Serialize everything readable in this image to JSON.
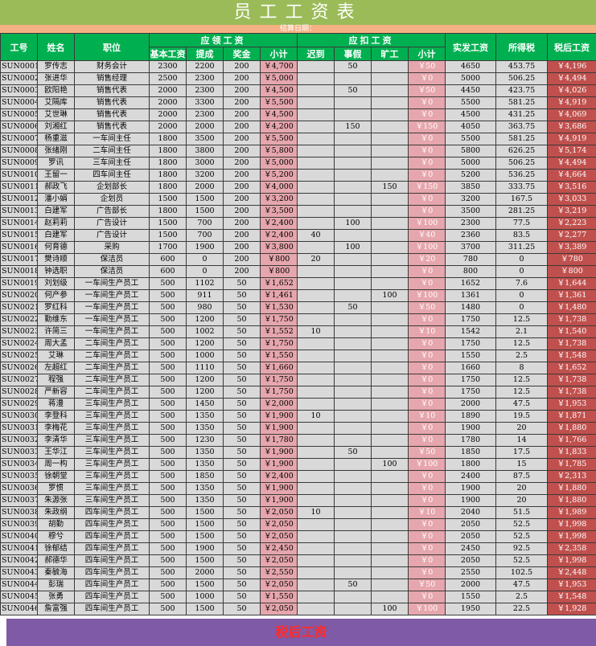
{
  "title": "员工工资表",
  "date_label": "结算日期：",
  "headers": {
    "id": "工号",
    "name": "姓名",
    "position": "职位",
    "payable_group": "应领工资",
    "base": "基本工资",
    "commission": "提成",
    "bonus": "奖金",
    "payable_subtotal": "小计",
    "deduct_group": "应扣工资",
    "late": "迟到",
    "leave": "事假",
    "absent": "旷工",
    "deduct_subtotal": "小计",
    "actual": "实发工资",
    "tax": "所得税",
    "after_tax": "税后工资"
  },
  "rows": [
    {
      "id": "SUN0001",
      "name": "罗传志",
      "position": "财务会计",
      "base": "2300",
      "commission": "2200",
      "bonus": "200",
      "subtotal": "￥4,700",
      "late": "",
      "leave": "50",
      "absent": "",
      "deduct": "￥50",
      "actual": "4650",
      "tax": "453.75",
      "after_tax": "￥4,196"
    },
    {
      "id": "SUN0002",
      "name": "张进华",
      "position": "销售经理",
      "base": "2500",
      "commission": "2300",
      "bonus": "200",
      "subtotal": "￥5,000",
      "late": "",
      "leave": "",
      "absent": "",
      "deduct": "￥0",
      "actual": "5000",
      "tax": "506.25",
      "after_tax": "￥4,494"
    },
    {
      "id": "SUN0003",
      "name": "欧阳艳",
      "position": "销售代表",
      "base": "2000",
      "commission": "2300",
      "bonus": "200",
      "subtotal": "￥4,500",
      "late": "",
      "leave": "50",
      "absent": "",
      "deduct": "￥50",
      "actual": "4450",
      "tax": "423.75",
      "after_tax": "￥4,026"
    },
    {
      "id": "SUN0004",
      "name": "艾隔库",
      "position": "销售代表",
      "base": "2000",
      "commission": "3300",
      "bonus": "200",
      "subtotal": "￥5,500",
      "late": "",
      "leave": "",
      "absent": "",
      "deduct": "￥0",
      "actual": "5500",
      "tax": "581.25",
      "after_tax": "￥4,919"
    },
    {
      "id": "SUN0005",
      "name": "艾世琳",
      "position": "销售代表",
      "base": "2000",
      "commission": "2300",
      "bonus": "200",
      "subtotal": "￥4,500",
      "late": "",
      "leave": "",
      "absent": "",
      "deduct": "￥0",
      "actual": "4500",
      "tax": "431.25",
      "after_tax": "￥4,069"
    },
    {
      "id": "SUN0006",
      "name": "刘湘红",
      "position": "销售代表",
      "base": "2000",
      "commission": "2000",
      "bonus": "200",
      "subtotal": "￥4,200",
      "late": "",
      "leave": "150",
      "absent": "",
      "deduct": "￥150",
      "actual": "4050",
      "tax": "363.75",
      "after_tax": "￥3,686"
    },
    {
      "id": "SUN0007",
      "name": "杨重滋",
      "position": "一车间主任",
      "base": "1800",
      "commission": "3500",
      "bonus": "200",
      "subtotal": "￥5,500",
      "late": "",
      "leave": "",
      "absent": "",
      "deduct": "￥0",
      "actual": "5500",
      "tax": "581.25",
      "after_tax": "￥4,919"
    },
    {
      "id": "SUN0008",
      "name": "张绪刚",
      "position": "二车间主任",
      "base": "1800",
      "commission": "3800",
      "bonus": "200",
      "subtotal": "￥5,800",
      "late": "",
      "leave": "",
      "absent": "",
      "deduct": "￥0",
      "actual": "5800",
      "tax": "626.25",
      "after_tax": "￥5,174"
    },
    {
      "id": "SUN0009",
      "name": "罗讯",
      "position": "三车间主任",
      "base": "1800",
      "commission": "3000",
      "bonus": "200",
      "subtotal": "￥5,000",
      "late": "",
      "leave": "",
      "absent": "",
      "deduct": "￥0",
      "actual": "5000",
      "tax": "506.25",
      "after_tax": "￥4,494"
    },
    {
      "id": "SUN0010",
      "name": "王留一",
      "position": "四车间主任",
      "base": "1800",
      "commission": "3200",
      "bonus": "200",
      "subtotal": "￥5,200",
      "late": "",
      "leave": "",
      "absent": "",
      "deduct": "￥0",
      "actual": "5200",
      "tax": "536.25",
      "after_tax": "￥4,664"
    },
    {
      "id": "SUN0011",
      "name": "郝政飞",
      "position": "企划部长",
      "base": "1800",
      "commission": "2000",
      "bonus": "200",
      "subtotal": "￥4,000",
      "late": "",
      "leave": "",
      "absent": "150",
      "deduct": "￥150",
      "actual": "3850",
      "tax": "333.75",
      "after_tax": "￥3,516"
    },
    {
      "id": "SUN0012",
      "name": "潘小娟",
      "position": "企划员",
      "base": "1500",
      "commission": "1500",
      "bonus": "200",
      "subtotal": "￥3,200",
      "late": "",
      "leave": "",
      "absent": "",
      "deduct": "￥0",
      "actual": "3200",
      "tax": "167.5",
      "after_tax": "￥3,033"
    },
    {
      "id": "SUN0013",
      "name": "白建军",
      "position": "广告部长",
      "base": "1800",
      "commission": "1500",
      "bonus": "200",
      "subtotal": "￥3,500",
      "late": "",
      "leave": "",
      "absent": "",
      "deduct": "￥0",
      "actual": "3500",
      "tax": "281.25",
      "after_tax": "￥3,219"
    },
    {
      "id": "SUN0014",
      "name": "赵莉莉",
      "position": "广告设计",
      "base": "1500",
      "commission": "700",
      "bonus": "200",
      "subtotal": "￥2,400",
      "late": "",
      "leave": "100",
      "absent": "",
      "deduct": "￥100",
      "actual": "2300",
      "tax": "77.5",
      "after_tax": "￥2,223"
    },
    {
      "id": "SUN0015",
      "name": "白建军",
      "position": "广告设计",
      "base": "1500",
      "commission": "700",
      "bonus": "200",
      "subtotal": "￥2,400",
      "late": "40",
      "leave": "",
      "absent": "",
      "deduct": "￥40",
      "actual": "2360",
      "tax": "83.5",
      "after_tax": "￥2,277"
    },
    {
      "id": "SUN0016",
      "name": "何育德",
      "position": "采购",
      "base": "1700",
      "commission": "1900",
      "bonus": "200",
      "subtotal": "￥3,800",
      "late": "",
      "leave": "100",
      "absent": "",
      "deduct": "￥100",
      "actual": "3700",
      "tax": "311.25",
      "after_tax": "￥3,389"
    },
    {
      "id": "SUN0017",
      "name": "樊诗顺",
      "position": "保洁员",
      "base": "600",
      "commission": "0",
      "bonus": "200",
      "subtotal": "￥800",
      "late": "20",
      "leave": "",
      "absent": "",
      "deduct": "￥20",
      "actual": "780",
      "tax": "0",
      "after_tax": "￥780"
    },
    {
      "id": "SUN0018",
      "name": "钟选职",
      "position": "保洁员",
      "base": "600",
      "commission": "0",
      "bonus": "200",
      "subtotal": "￥800",
      "late": "",
      "leave": "",
      "absent": "",
      "deduct": "￥0",
      "actual": "800",
      "tax": "0",
      "after_tax": "￥800"
    },
    {
      "id": "SUN0019",
      "name": "刘划级",
      "position": "一车间生产员工",
      "base": "500",
      "commission": "1102",
      "bonus": "50",
      "subtotal": "￥1,652",
      "late": "",
      "leave": "",
      "absent": "",
      "deduct": "￥0",
      "actual": "1652",
      "tax": "7.6",
      "after_tax": "￥1,644"
    },
    {
      "id": "SUN0020",
      "name": "何产参",
      "position": "一车间生产员工",
      "base": "500",
      "commission": "911",
      "bonus": "50",
      "subtotal": "￥1,461",
      "late": "",
      "leave": "",
      "absent": "100",
      "deduct": "￥100",
      "actual": "1361",
      "tax": "0",
      "after_tax": "￥1,361"
    },
    {
      "id": "SUN0021",
      "name": "罗红科",
      "position": "一车间生产员工",
      "base": "500",
      "commission": "980",
      "bonus": "50",
      "subtotal": "￥1,530",
      "late": "",
      "leave": "50",
      "absent": "",
      "deduct": "￥50",
      "actual": "1480",
      "tax": "0",
      "after_tax": "￥1,480"
    },
    {
      "id": "SUN0022",
      "name": "勤维东",
      "position": "一车间生产员工",
      "base": "500",
      "commission": "1200",
      "bonus": "50",
      "subtotal": "￥1,750",
      "late": "",
      "leave": "",
      "absent": "",
      "deduct": "￥0",
      "actual": "1750",
      "tax": "12.5",
      "after_tax": "￥1,738"
    },
    {
      "id": "SUN0023",
      "name": "许简三",
      "position": "一车间生产员工",
      "base": "500",
      "commission": "1002",
      "bonus": "50",
      "subtotal": "￥1,552",
      "late": "10",
      "leave": "",
      "absent": "",
      "deduct": "￥10",
      "actual": "1542",
      "tax": "2.1",
      "after_tax": "￥1,540"
    },
    {
      "id": "SUN0024",
      "name": "周大孟",
      "position": "二车间生产员工",
      "base": "500",
      "commission": "1200",
      "bonus": "50",
      "subtotal": "￥1,750",
      "late": "",
      "leave": "",
      "absent": "",
      "deduct": "￥0",
      "actual": "1750",
      "tax": "12.5",
      "after_tax": "￥1,738"
    },
    {
      "id": "SUN0025",
      "name": "艾琳",
      "position": "二车间生产员工",
      "base": "500",
      "commission": "1000",
      "bonus": "50",
      "subtotal": "￥1,550",
      "late": "",
      "leave": "",
      "absent": "",
      "deduct": "￥0",
      "actual": "1550",
      "tax": "2.5",
      "after_tax": "￥1,548"
    },
    {
      "id": "SUN0026",
      "name": "左超红",
      "position": "二车间生产员工",
      "base": "500",
      "commission": "1110",
      "bonus": "50",
      "subtotal": "￥1,660",
      "late": "",
      "leave": "",
      "absent": "",
      "deduct": "￥0",
      "actual": "1660",
      "tax": "8",
      "after_tax": "￥1,652"
    },
    {
      "id": "SUN0027",
      "name": "程强",
      "position": "二车间生产员工",
      "base": "500",
      "commission": "1200",
      "bonus": "50",
      "subtotal": "￥1,750",
      "late": "",
      "leave": "",
      "absent": "",
      "deduct": "￥0",
      "actual": "1750",
      "tax": "12.5",
      "after_tax": "￥1,738"
    },
    {
      "id": "SUN0028",
      "name": "严新容",
      "position": "二车间生产员工",
      "base": "500",
      "commission": "1200",
      "bonus": "50",
      "subtotal": "￥1,750",
      "late": "",
      "leave": "",
      "absent": "",
      "deduct": "￥0",
      "actual": "1750",
      "tax": "12.5",
      "after_tax": "￥1,738"
    },
    {
      "id": "SUN0029",
      "name": "蒋澧",
      "position": "三车间生产员工",
      "base": "500",
      "commission": "1450",
      "bonus": "50",
      "subtotal": "￥2,000",
      "late": "",
      "leave": "",
      "absent": "",
      "deduct": "￥0",
      "actual": "2000",
      "tax": "47.5",
      "after_tax": "￥1,953"
    },
    {
      "id": "SUN0030",
      "name": "李登科",
      "position": "三车间生产员工",
      "base": "500",
      "commission": "1350",
      "bonus": "50",
      "subtotal": "￥1,900",
      "late": "10",
      "leave": "",
      "absent": "",
      "deduct": "￥10",
      "actual": "1890",
      "tax": "19.5",
      "after_tax": "￥1,871"
    },
    {
      "id": "SUN0031",
      "name": "李梅花",
      "position": "三车间生产员工",
      "base": "500",
      "commission": "1350",
      "bonus": "50",
      "subtotal": "￥1,900",
      "late": "",
      "leave": "",
      "absent": "",
      "deduct": "￥0",
      "actual": "1900",
      "tax": "20",
      "after_tax": "￥1,880"
    },
    {
      "id": "SUN0032",
      "name": "李清华",
      "position": "三车间生产员工",
      "base": "500",
      "commission": "1230",
      "bonus": "50",
      "subtotal": "￥1,780",
      "late": "",
      "leave": "",
      "absent": "",
      "deduct": "￥0",
      "actual": "1780",
      "tax": "14",
      "after_tax": "￥1,766"
    },
    {
      "id": "SUN0033",
      "name": "王华江",
      "position": "三车间生产员工",
      "base": "500",
      "commission": "1350",
      "bonus": "50",
      "subtotal": "￥1,900",
      "late": "",
      "leave": "50",
      "absent": "",
      "deduct": "￥50",
      "actual": "1850",
      "tax": "17.5",
      "after_tax": "￥1,833"
    },
    {
      "id": "SUN0034",
      "name": "周一构",
      "position": "三车间生产员工",
      "base": "500",
      "commission": "1350",
      "bonus": "50",
      "subtotal": "￥1,900",
      "late": "",
      "leave": "",
      "absent": "100",
      "deduct": "￥100",
      "actual": "1800",
      "tax": "15",
      "after_tax": "￥1,785"
    },
    {
      "id": "SUN0035",
      "name": "徐朝堂",
      "position": "三车间生产员工",
      "base": "500",
      "commission": "1850",
      "bonus": "50",
      "subtotal": "￥2,400",
      "late": "",
      "leave": "",
      "absent": "",
      "deduct": "￥0",
      "actual": "2400",
      "tax": "87.5",
      "after_tax": "￥2,313"
    },
    {
      "id": "SUN0036",
      "name": "罗惯",
      "position": "三车间生产员工",
      "base": "500",
      "commission": "1350",
      "bonus": "50",
      "subtotal": "￥1,900",
      "late": "",
      "leave": "",
      "absent": "",
      "deduct": "￥0",
      "actual": "1900",
      "tax": "20",
      "after_tax": "￥1,880"
    },
    {
      "id": "SUN0037",
      "name": "朱源张",
      "position": "三车间生产员工",
      "base": "500",
      "commission": "1350",
      "bonus": "50",
      "subtotal": "￥1,900",
      "late": "",
      "leave": "",
      "absent": "",
      "deduct": "￥0",
      "actual": "1900",
      "tax": "20",
      "after_tax": "￥1,880"
    },
    {
      "id": "SUN0038",
      "name": "朱政纲",
      "position": "四车间生产员工",
      "base": "500",
      "commission": "1500",
      "bonus": "50",
      "subtotal": "￥2,050",
      "late": "10",
      "leave": "",
      "absent": "",
      "deduct": "￥10",
      "actual": "2040",
      "tax": "51.5",
      "after_tax": "￥1,989"
    },
    {
      "id": "SUN0039",
      "name": "胡勤",
      "position": "四车间生产员工",
      "base": "500",
      "commission": "1500",
      "bonus": "50",
      "subtotal": "￥2,050",
      "late": "",
      "leave": "",
      "absent": "",
      "deduct": "￥0",
      "actual": "2050",
      "tax": "52.5",
      "after_tax": "￥1,998"
    },
    {
      "id": "SUN0040",
      "name": "穆兮",
      "position": "四车间生产员工",
      "base": "500",
      "commission": "1500",
      "bonus": "50",
      "subtotal": "￥2,050",
      "late": "",
      "leave": "",
      "absent": "",
      "deduct": "￥0",
      "actual": "2050",
      "tax": "52.5",
      "after_tax": "￥1,998"
    },
    {
      "id": "SUN0041",
      "name": "徐郁结",
      "position": "四车间生产员工",
      "base": "500",
      "commission": "1900",
      "bonus": "50",
      "subtotal": "￥2,450",
      "late": "",
      "leave": "",
      "absent": "",
      "deduct": "￥0",
      "actual": "2450",
      "tax": "92.5",
      "after_tax": "￥2,358"
    },
    {
      "id": "SUN0042",
      "name": "郝德华",
      "position": "四车间生产员工",
      "base": "500",
      "commission": "1500",
      "bonus": "50",
      "subtotal": "￥2,050",
      "late": "",
      "leave": "",
      "absent": "",
      "deduct": "￥0",
      "actual": "2050",
      "tax": "52.5",
      "after_tax": "￥1,998"
    },
    {
      "id": "SUN0043",
      "name": "秦毓海",
      "position": "四车间生产员工",
      "base": "500",
      "commission": "2000",
      "bonus": "50",
      "subtotal": "￥2,550",
      "late": "",
      "leave": "",
      "absent": "",
      "deduct": "￥0",
      "actual": "2550",
      "tax": "102.5",
      "after_tax": "￥2,448"
    },
    {
      "id": "SUN0044",
      "name": "彭瑞",
      "position": "四车间生产员工",
      "base": "500",
      "commission": "1500",
      "bonus": "50",
      "subtotal": "￥2,050",
      "late": "",
      "leave": "50",
      "absent": "",
      "deduct": "￥50",
      "actual": "2000",
      "tax": "47.5",
      "after_tax": "￥1,953"
    },
    {
      "id": "SUN0045",
      "name": "张勇",
      "position": "四车间生产员工",
      "base": "500",
      "commission": "1000",
      "bonus": "50",
      "subtotal": "￥1,550",
      "late": "",
      "leave": "",
      "absent": "",
      "deduct": "￥0",
      "actual": "1550",
      "tax": "2.5",
      "after_tax": "￥1,548"
    },
    {
      "id": "SUN0046",
      "name": "詹富强",
      "position": "四车间生产员工",
      "base": "500",
      "commission": "1500",
      "bonus": "50",
      "subtotal": "￥2,050",
      "late": "",
      "leave": "",
      "absent": "100",
      "deduct": "￥100",
      "actual": "1950",
      "tax": "22.5",
      "after_tax": "￥1,928"
    }
  ],
  "footer_label": "税后工资",
  "colors": {
    "title_bg": "#9bbb59",
    "date_bg": "#f4b183",
    "header_bg": "#00b050",
    "row_bg": "#d9d9d9",
    "pink_col": "#e6a6ad",
    "after_tax_col": "#c0504d",
    "footer_bg": "#7f5aa6",
    "footer_text": "#ff2a2a"
  }
}
